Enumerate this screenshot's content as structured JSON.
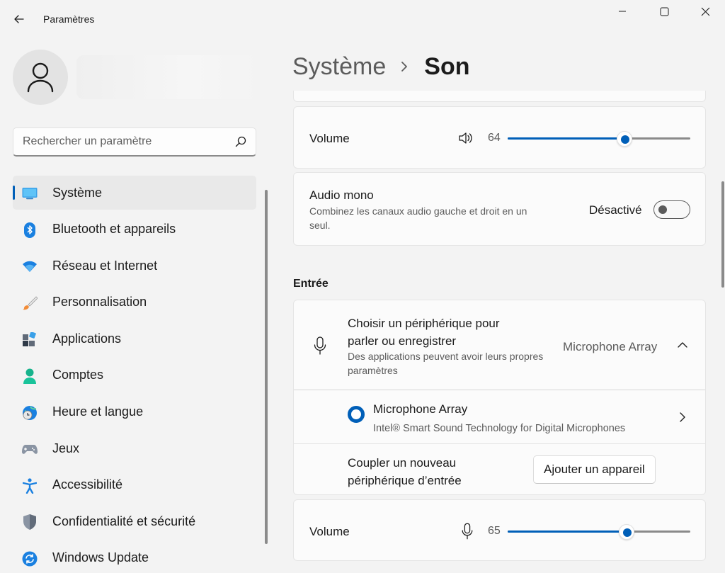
{
  "window": {
    "title": "Paramètres"
  },
  "search": {
    "placeholder": "Rechercher un paramètre"
  },
  "sidebar": {
    "items": [
      {
        "label": "Système",
        "active": true
      },
      {
        "label": "Bluetooth et appareils"
      },
      {
        "label": "Réseau et Internet"
      },
      {
        "label": "Personnalisation"
      },
      {
        "label": "Applications"
      },
      {
        "label": "Comptes"
      },
      {
        "label": "Heure et langue"
      },
      {
        "label": "Jeux"
      },
      {
        "label": "Accessibilité"
      },
      {
        "label": "Confidentialité et sécurité"
      },
      {
        "label": "Windows Update"
      }
    ]
  },
  "breadcrumb": {
    "parent": "Système",
    "current": "Son"
  },
  "output_volume": {
    "label": "Volume",
    "value": "64",
    "percent": 64,
    "icon": "speaker-icon"
  },
  "mono_audio": {
    "title": "Audio mono",
    "description": "Combinez les canaux audio gauche et droit en un seul.",
    "state_label": "Désactivé",
    "on": false
  },
  "input": {
    "section_title": "Entrée",
    "choose_device": {
      "title": "Choisir un périphérique pour parler ou enregistrer",
      "description": "Des applications peuvent avoir leurs propres paramètres",
      "selected": "Microphone Array",
      "expanded": true
    },
    "device": {
      "name": "Microphone Array",
      "detail": "Intel® Smart Sound Technology for Digital Microphones",
      "selected": true
    },
    "pair": {
      "label": "Coupler un nouveau périphérique d’entrée",
      "button": "Ajouter un appareil"
    },
    "volume": {
      "label": "Volume",
      "value": "65",
      "percent": 65,
      "icon": "microphone-icon"
    }
  },
  "colors": {
    "accent": "#005fb8",
    "background": "#f3f3f3",
    "card": "#fbfbfb"
  }
}
